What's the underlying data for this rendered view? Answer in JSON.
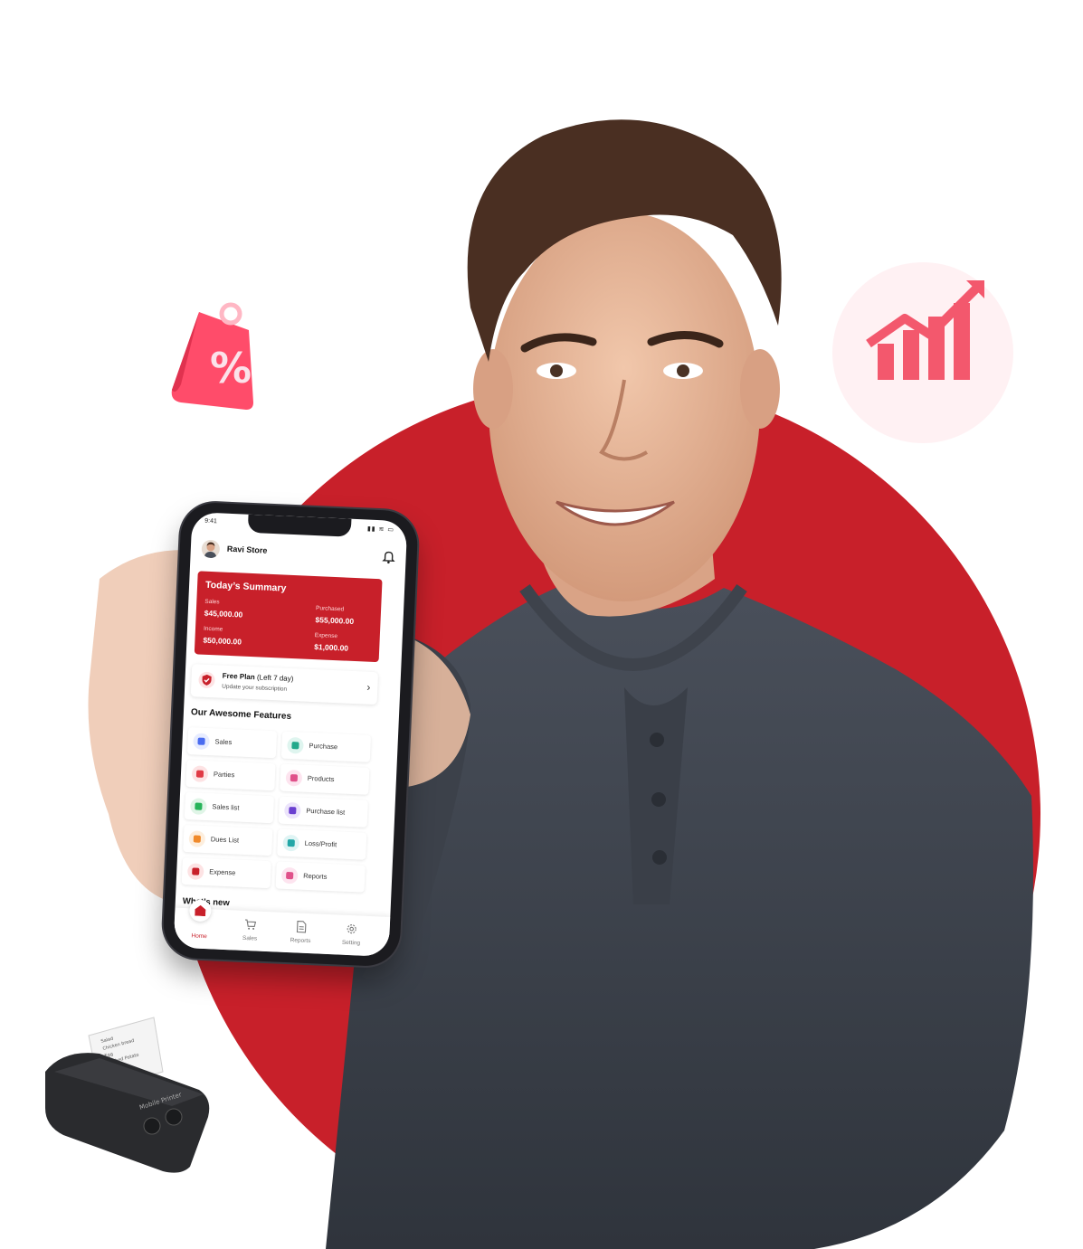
{
  "colors": {
    "brand_red": "#c8202a",
    "screen_bg": "#ffffff"
  },
  "status_bar": {
    "time": "9:41",
    "icons": "▮▮ ≋ ▭"
  },
  "header": {
    "store_name": "Ravi Store",
    "avatar_icon": "avatar",
    "bell_icon": "bell-icon"
  },
  "summary": {
    "title": "Today’s Summary",
    "items": [
      {
        "label": "Sales",
        "value": "$45,000.00"
      },
      {
        "label": "Purchased",
        "value": "$55,000.00"
      },
      {
        "label": "Income",
        "value": "$50,000.00"
      },
      {
        "label": "Expense",
        "value": "$1,000.00"
      }
    ]
  },
  "plan": {
    "title": "Free Plan",
    "note": "(Left 7 day)",
    "subtitle": "Update your subscription",
    "icon": "shield-icon"
  },
  "features": {
    "title": "Our Awesome Features",
    "items": [
      {
        "label": "Sales",
        "icon": "cart-icon",
        "color": "#4a6cf0",
        "bg": "#e7ecff"
      },
      {
        "label": "Purchase",
        "icon": "purchase-icon",
        "color": "#22a98b",
        "bg": "#dff5ef"
      },
      {
        "label": "Parties",
        "icon": "people-icon",
        "color": "#e03a45",
        "bg": "#fde3e4"
      },
      {
        "label": "Products",
        "icon": "box-icon",
        "color": "#e0518a",
        "bg": "#fde4ef"
      },
      {
        "label": "Sales list",
        "icon": "list-icon",
        "color": "#27b45a",
        "bg": "#e0f5e7"
      },
      {
        "label": "Purchase list",
        "icon": "document-icon",
        "color": "#6a3fd0",
        "bg": "#ece4fb"
      },
      {
        "label": "Dues List",
        "icon": "clipboard-icon",
        "color": "#f08a2b",
        "bg": "#fdeedd"
      },
      {
        "label": "Loss/Profit",
        "icon": "bar-chart-icon",
        "color": "#22a7a7",
        "bg": "#dff4f4"
      },
      {
        "label": "Expense",
        "icon": "expense-icon",
        "color": "#c8202a",
        "bg": "#fde3e4"
      },
      {
        "label": "Reports",
        "icon": "report-icon",
        "color": "#e0518a",
        "bg": "#fde4ef"
      }
    ]
  },
  "whats_new": "What’s new",
  "tabs": [
    {
      "label": "Home",
      "icon": "home-icon",
      "active": true
    },
    {
      "label": "Sales",
      "icon": "cart-icon",
      "active": false
    },
    {
      "label": "Reports",
      "icon": "document-icon",
      "active": false
    },
    {
      "label": "Setting",
      "icon": "gear-icon",
      "active": false
    }
  ],
  "decorations": {
    "tag_icon": "percent-tag-icon",
    "growth_icon": "growth-chart-icon",
    "printer_icon": "mobile-printer-icon",
    "printer_label": "Mobile Printer"
  }
}
